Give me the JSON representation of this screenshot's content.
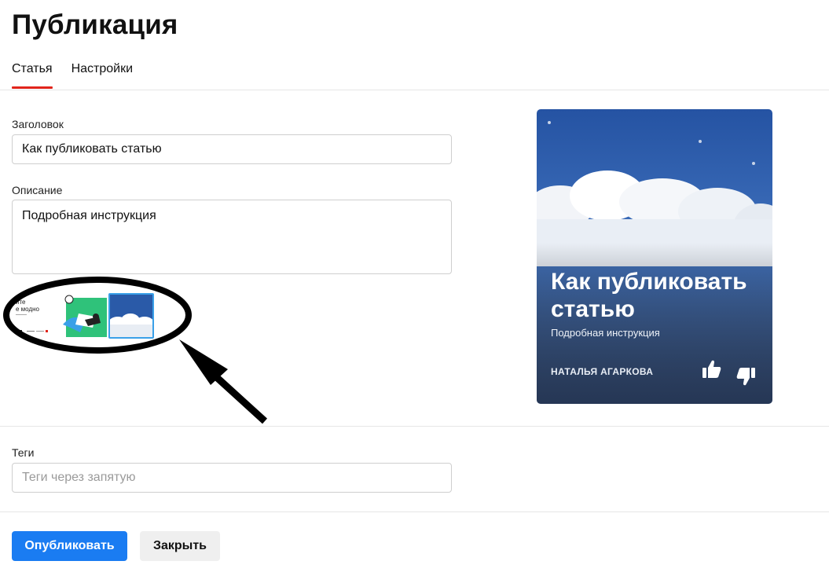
{
  "header": {
    "title": "Публикация"
  },
  "tabs": [
    {
      "label": "Статья",
      "active": true
    },
    {
      "label": "Настройки",
      "active": false
    }
  ],
  "form": {
    "title_field": {
      "label": "Заголовок",
      "value": "Как публиковать статью"
    },
    "description_field": {
      "label": "Описание",
      "value": "Подробная инструкция"
    },
    "tags_field": {
      "label": "Теги",
      "value": "",
      "placeholder": "Теги через запятую"
    }
  },
  "cover_thumbnails": {
    "items": [
      {
        "name": "text-cover",
        "text_line1": "йте",
        "text_line2": "е модно"
      },
      {
        "name": "illustration-cover"
      },
      {
        "name": "clouds-cover",
        "selected": true
      }
    ],
    "selected_border_color": "#3aa0e8"
  },
  "preview": {
    "title": "Как публиковать статью",
    "description": "Подробная инструкция",
    "author": "НАТАЛЬЯ АГАРКОВА",
    "icons": [
      "thumbs-up-icon",
      "thumbs-down-icon"
    ]
  },
  "actions": {
    "publish_label": "Опубликовать",
    "close_label": "Закрыть"
  },
  "colors": {
    "accent": "#1a7cf2",
    "tab_underline": "#e1251b",
    "sky": "#2a5aa8"
  }
}
